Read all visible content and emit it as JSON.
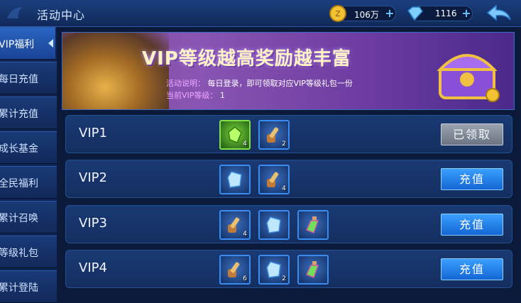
{
  "header": {
    "title": "活动中心",
    "gold_value": "106万",
    "diamond_value": "1116"
  },
  "sidebar": {
    "items": [
      {
        "label": "VIP福利",
        "active": true
      },
      {
        "label": "每日充值"
      },
      {
        "label": "累计充值"
      },
      {
        "label": "成长基金"
      },
      {
        "label": "全民福利"
      },
      {
        "label": "累计召唤"
      },
      {
        "label": "等级礼包"
      },
      {
        "label": "累计登陆"
      }
    ]
  },
  "banner": {
    "headline": "VIP等级越高奖励越丰富",
    "desc_key": "活动说明：",
    "desc_value": "每日登录，即可领取对应VIP等级礼包一份",
    "level_key": "当前VIP等级：",
    "level_value": "1"
  },
  "rows": [
    {
      "label": "VIP1",
      "items": [
        {
          "icon": "green-gem-icon",
          "count": "4"
        },
        {
          "icon": "scroll-icon",
          "count": "2"
        }
      ],
      "button": "已领取",
      "button_state": "claimed"
    },
    {
      "label": "VIP2",
      "items": [
        {
          "icon": "blue-crystal-icon",
          "count": ""
        },
        {
          "icon": "scroll-icon",
          "count": "4"
        }
      ],
      "button": "充值",
      "button_state": "recharge"
    },
    {
      "label": "VIP3",
      "items": [
        {
          "icon": "scroll-icon",
          "count": "4"
        },
        {
          "icon": "blue-crystal-icon",
          "count": ""
        },
        {
          "icon": "potion-icon",
          "count": ""
        }
      ],
      "button": "充值",
      "button_state": "recharge"
    },
    {
      "label": "VIP4",
      "items": [
        {
          "icon": "scroll-icon",
          "count": "6"
        },
        {
          "icon": "blue-crystal-icon",
          "count": "2"
        },
        {
          "icon": "potion-icon",
          "count": ""
        }
      ],
      "button": "充值",
      "button_state": "recharge"
    }
  ],
  "colors": {
    "accent": "#1466d4",
    "claimed": "#6b7482"
  }
}
